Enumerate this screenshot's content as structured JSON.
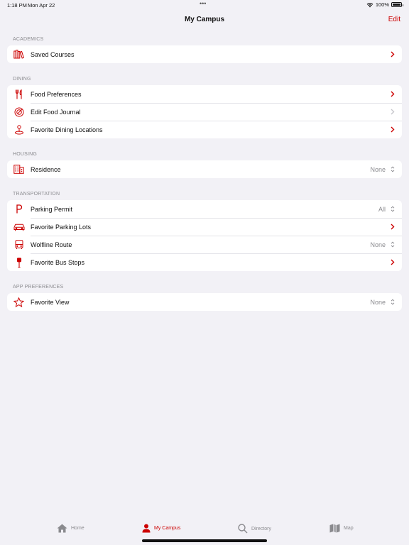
{
  "status": {
    "time": "1:18 PM",
    "date": "Mon Apr 22",
    "battery": "100%",
    "dots": "•••"
  },
  "nav": {
    "title": "My Campus",
    "edit": "Edit"
  },
  "colors": {
    "accent": "#cc0000",
    "secondary_text": "#8a8a8e",
    "background": "#f2f1f6"
  },
  "sections": {
    "academics": {
      "header": "ACADEMICS",
      "items": [
        {
          "label": "Saved Courses",
          "icon": "books-icon"
        }
      ]
    },
    "dining": {
      "header": "DINING",
      "items": [
        {
          "label": "Food Preferences",
          "icon": "fork-knife-icon"
        },
        {
          "label": "Edit Food Journal",
          "icon": "plate-icon"
        },
        {
          "label": "Favorite Dining Locations",
          "icon": "location-pin-icon"
        }
      ]
    },
    "housing": {
      "header": "HOUSING",
      "items": [
        {
          "label": "Residence",
          "value": "None",
          "icon": "building-icon"
        }
      ]
    },
    "transportation": {
      "header": "TRANSPORTATION",
      "items": [
        {
          "label": "Parking Permit",
          "value": "All",
          "icon": "parking-icon"
        },
        {
          "label": "Favorite Parking Lots",
          "icon": "car-icon"
        },
        {
          "label": "Wolfline Route",
          "value": "None",
          "icon": "bus-icon"
        },
        {
          "label": "Favorite Bus Stops",
          "icon": "bus-stop-icon"
        }
      ]
    },
    "app_preferences": {
      "header": "APP PREFERENCES",
      "items": [
        {
          "label": "Favorite View",
          "value": "None",
          "icon": "star-icon"
        }
      ]
    }
  },
  "tabs": [
    {
      "label": "Home",
      "icon": "home-icon"
    },
    {
      "label": "My Campus",
      "icon": "person-icon",
      "active": true
    },
    {
      "label": "Directory",
      "icon": "search-icon"
    },
    {
      "label": "Map",
      "icon": "map-icon"
    }
  ]
}
